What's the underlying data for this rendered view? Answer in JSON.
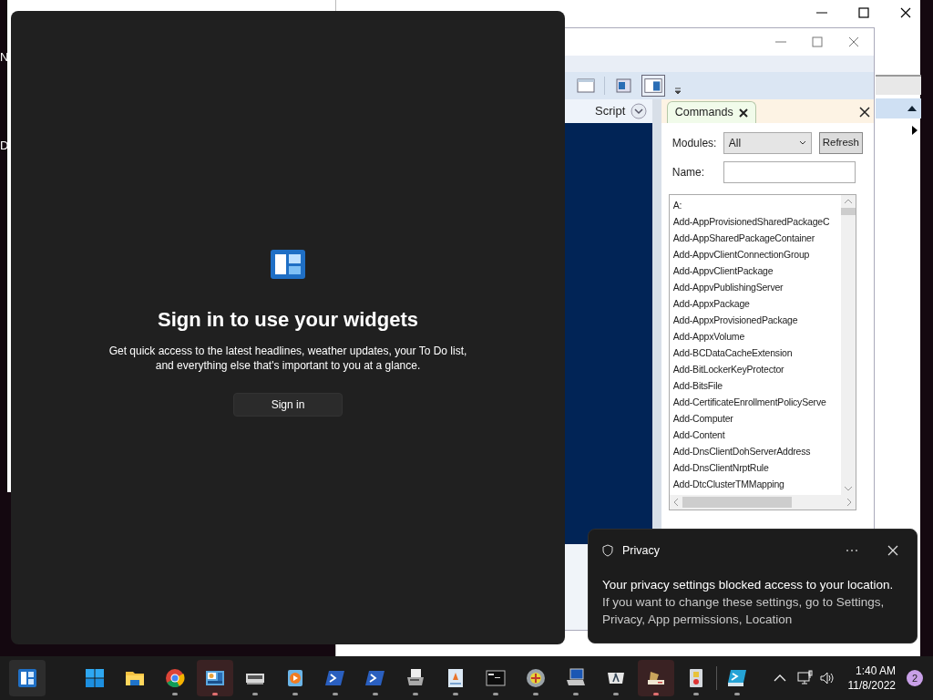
{
  "desktop_labels": [
    "N",
    "D"
  ],
  "ise": {
    "script_label": "Script",
    "commands_tab": {
      "label": "Commands",
      "selected": true
    },
    "modules_label": "Modules:",
    "modules_value": "All",
    "refresh": "Refresh",
    "name_label": "Name:",
    "commands": [
      "A:",
      "Add-AppProvisionedSharedPackageC",
      "Add-AppSharedPackageContainer",
      "Add-AppvClientConnectionGroup",
      "Add-AppvClientPackage",
      "Add-AppvPublishingServer",
      "Add-AppxPackage",
      "Add-AppxProvisionedPackage",
      "Add-AppxVolume",
      "Add-BCDataCacheExtension",
      "Add-BitLockerKeyProtector",
      "Add-BitsFile",
      "Add-CertificateEnrollmentPolicyServe",
      "Add-Computer",
      "Add-Content",
      "Add-DnsClientDohServerAddress",
      "Add-DnsClientNrptRule",
      "Add-DtcClusterTMMapping"
    ]
  },
  "widgets": {
    "title": "Sign in to use your widgets",
    "message": "Get quick access to the latest headlines, weather updates, your To Do list, and everything else that's important to you at a glance.",
    "sign_in": "Sign in"
  },
  "notification": {
    "title": "Privacy",
    "message": "Your privacy settings blocked access to your location.",
    "detail": "If you want to change these settings, go to Settings, Privacy, App permissions, Location"
  },
  "taskbar": {
    "apps": [
      {
        "kind": "widgets",
        "running": false,
        "active": true
      },
      {
        "kind": "start",
        "running": false,
        "active": false
      },
      {
        "kind": "folder",
        "running": false,
        "active": false
      },
      {
        "kind": "browser",
        "running": true,
        "active": false
      },
      {
        "kind": "control-panel",
        "running": true,
        "active": true
      },
      {
        "kind": "memory",
        "running": true,
        "active": false
      },
      {
        "kind": "media",
        "running": true,
        "active": false
      },
      {
        "kind": "powershell",
        "running": true,
        "active": false
      },
      {
        "kind": "powershell",
        "running": true,
        "active": false
      },
      {
        "kind": "fax",
        "running": true,
        "active": false
      },
      {
        "kind": "document",
        "running": true,
        "active": false
      },
      {
        "kind": "terminal",
        "running": true,
        "active": false
      },
      {
        "kind": "disc",
        "running": true,
        "active": false
      },
      {
        "kind": "computer",
        "running": true,
        "active": false
      },
      {
        "kind": "lambda",
        "running": true,
        "active": false
      },
      {
        "kind": "drive",
        "running": true,
        "active": true
      },
      {
        "kind": "security",
        "running": true,
        "active": false
      },
      {
        "kind": "separator"
      },
      {
        "kind": "ise",
        "running": true,
        "active": false
      }
    ],
    "time": "1:40 AM",
    "date": "11/8/2022",
    "notification_count": "2"
  }
}
